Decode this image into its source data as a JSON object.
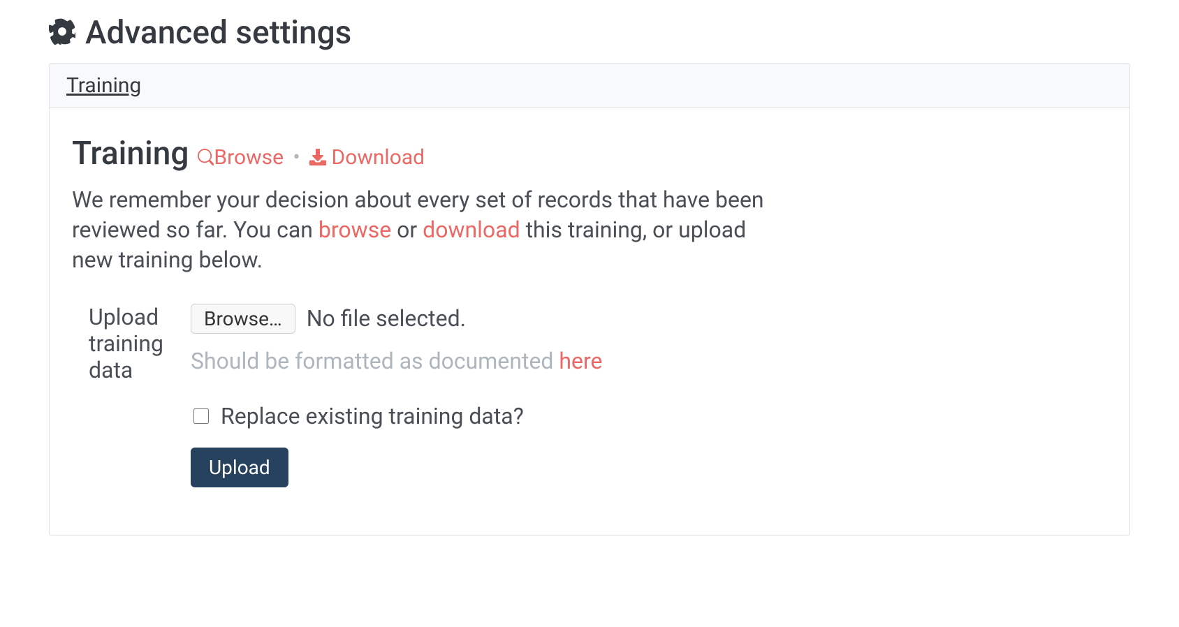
{
  "page_title": "Advanced settings",
  "tabs": [
    {
      "label": "Training"
    }
  ],
  "training": {
    "heading": "Training",
    "browse_link": "Browse",
    "download_link": "Download",
    "separator": "•",
    "description_parts": {
      "p1": "We remember your decision about every set of records that have been reviewed so far. You can ",
      "browse": "browse",
      "p2": " or ",
      "download": "download",
      "p3": " this training, or upload new training below."
    },
    "upload_label": "Upload training data",
    "file_button": "Browse…",
    "file_status": "No file selected.",
    "help_prefix": "Should be formatted as documented ",
    "help_link": "here",
    "replace_label": "Replace existing training data?",
    "submit_label": "Upload"
  }
}
